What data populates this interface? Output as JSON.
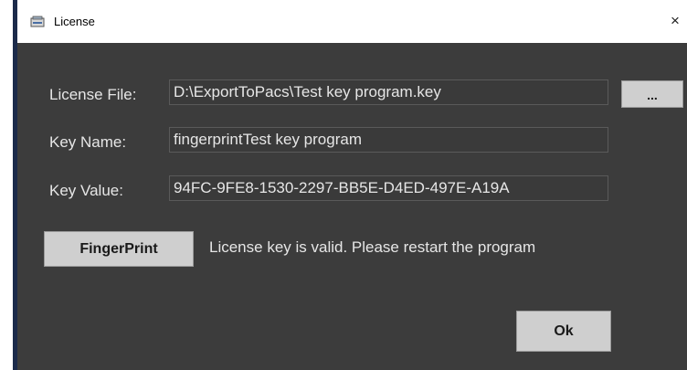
{
  "window": {
    "title": "License",
    "close_glyph": "×"
  },
  "form": {
    "license_file": {
      "label": "License File:",
      "value": "D:\\ExportToPacs\\Test key program.key"
    },
    "browse_button": "...",
    "key_name": {
      "label": "Key Name:",
      "value": "fingerprintTest key program"
    },
    "key_value": {
      "label": "Key Value:",
      "value": "94FC-9FE8-1530-2297-BB5E-D4ED-497E-A19A"
    }
  },
  "actions": {
    "fingerprint_button": "FingerPrint",
    "status_message": "License key is valid. Please restart the program",
    "ok_button": "Ok"
  },
  "icons": {
    "app": "license-app-icon",
    "close": "close-icon"
  }
}
